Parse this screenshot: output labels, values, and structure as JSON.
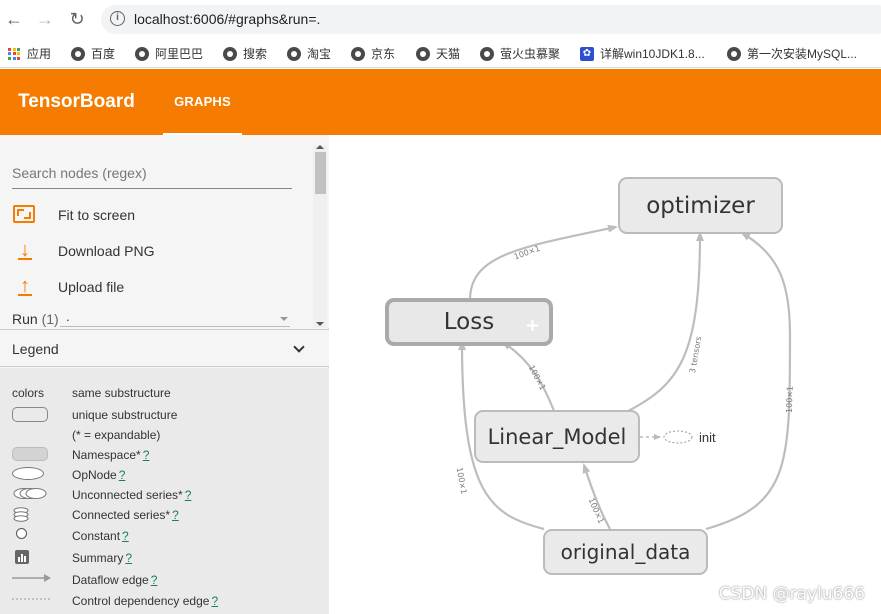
{
  "browser": {
    "url": "localhost:6006/#graphs&run=.",
    "bookmarks": [
      "应用",
      "百度",
      "阿里巴巴",
      "搜索",
      "淘宝",
      "京东",
      "天猫",
      "萤火虫慕聚",
      "详解win10JDK1.8...",
      "第一次安装MySQL..."
    ]
  },
  "header": {
    "title": "TensorBoard",
    "tab": "GRAPHS"
  },
  "sidebar": {
    "search_placeholder": "Search nodes (regex)",
    "actions": [
      "Fit to screen",
      "Download PNG",
      "Upload file"
    ],
    "run_label": "Run",
    "run_count": "(1)",
    "run_value": ".",
    "legend_title": "Legend",
    "legend": {
      "colors": "colors",
      "same_substructure": "same substructure",
      "unique_substructure": "unique substructure",
      "expandable_note": "(* = expandable)",
      "items": [
        {
          "label": "Namespace*",
          "help": "?"
        },
        {
          "label": "OpNode",
          "help": "?"
        },
        {
          "label": "Unconnected series*",
          "help": "?"
        },
        {
          "label": "Connected series*",
          "help": "?"
        },
        {
          "label": "Constant",
          "help": "?"
        },
        {
          "label": "Summary",
          "help": "?"
        },
        {
          "label": "Dataflow edge",
          "help": "?"
        },
        {
          "label": "Control dependency edge",
          "help": "?"
        }
      ]
    }
  },
  "graph": {
    "nodes": {
      "optimizer": "optimizer",
      "loss": "Loss",
      "linear_model": "Linear_Model",
      "original_data": "original_data",
      "init": "init"
    },
    "edge_labels": {
      "loss_to_optimizer": "100×1",
      "linear_to_optimizer": "3 tensors",
      "linear_to_loss": "100×1",
      "data_to_loss": "100×1",
      "data_to_linear": "100×1",
      "data_to_optimizer": "100×1"
    }
  },
  "watermark": "CSDN @raylu666",
  "colors": {
    "accent": "#f57c00",
    "node_fill": "#eaeaea",
    "node_border": "#bbbbbb",
    "edge": "#bdbdbd"
  }
}
